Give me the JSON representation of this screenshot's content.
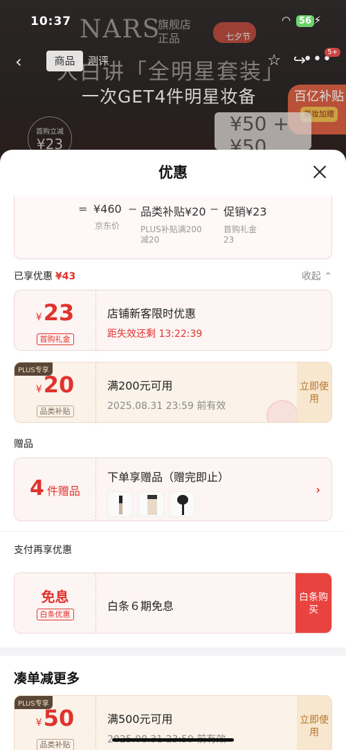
{
  "status_bar": {
    "time": "10:37",
    "battery": "56"
  },
  "background_page": {
    "brand": "NARS",
    "brand_tags": [
      "旗舰店",
      "正品"
    ],
    "festival_label": "七夕节",
    "tabs": [
      "商品",
      "测评"
    ],
    "headline": "大白讲「全明星套装」",
    "subline": "一次GET4件明星妆备",
    "message_count": "5+",
    "subsidy_bubble": {
      "title": "百亿补贴",
      "tag": "美妆加赠"
    },
    "first_purchase": {
      "label": "首购立减",
      "amount": "¥23"
    },
    "mini_cards": "¥50 + ¥50"
  },
  "sheet": {
    "title": "优惠",
    "formula": {
      "equals": "=",
      "total": "¥460",
      "total_label": "京东价",
      "minus1": "−",
      "subsidy": "品类补贴¥20",
      "subsidy_label": "PLUS补贴满200减20",
      "minus2": "−",
      "promo": "促销¥23",
      "promo_label": "首购礼金23"
    },
    "enjoyed": {
      "label": "已享优惠",
      "amount": "¥43",
      "collapse": "收起"
    },
    "coupons": [
      {
        "currency": "¥",
        "amount": "23",
        "tag": "首购礼金",
        "title": "店铺新客限时优惠",
        "sub": "距失效还剩 13:22:39"
      },
      {
        "badge": "PLUS专享",
        "currency": "¥",
        "amount": "20",
        "tag": "品类补贴",
        "title": "满200元可用",
        "sub": "2025.08.31 23:59 前有效",
        "action": "立即使用"
      }
    ],
    "gift_section": "赠品",
    "gift": {
      "count": "4",
      "unit": "件赠品",
      "title": "下单享赠品（赠完即止）"
    },
    "pay_section": "支付再享优惠",
    "pay": {
      "title_big": "免息",
      "tag": "白条优惠",
      "title": "白条６期免息",
      "action": "白条购买"
    },
    "more_title": "凑单减更多",
    "more_coupon": {
      "badge": "PLUS专享",
      "currency": "¥",
      "amount": "50",
      "tag": "品类补贴",
      "title": "满500元可用",
      "sub": "2025.08.31 23:59 前有效",
      "action": "立即使用"
    }
  }
}
